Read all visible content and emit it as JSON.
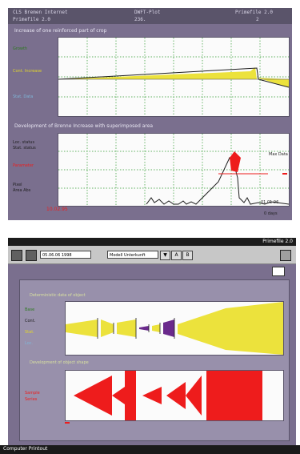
{
  "top_screen": {
    "title_left": "CLS Bremen Internet",
    "title_center": "DWFT-Plot",
    "title_right": "Primefile 2.0",
    "subtitle_left": "Primefile 2.0",
    "subtitle_center": "236.",
    "subtitle_right": "2",
    "panel1_title": "Increase of one reinforced part of crop",
    "panel1_legend": [
      "Growth",
      "Cont. Increase",
      "Stat. Data"
    ],
    "panel2_title": "Development of Brenne Increase with superimposed area",
    "panel2_legend_top": [
      "Loc. status",
      "Stat. status"
    ],
    "panel2_legend_mid": "Parameter",
    "panel2_legend_low": [
      "Pixel",
      "Area Abs"
    ],
    "panel2_date_left": "10.02.95",
    "panel2_date_right": "01.01.96",
    "panel2_right_label": "0 days",
    "panel2_right_top": "Max Data"
  },
  "bottom_screen": {
    "window_title": "Primefile 2.0",
    "toolbar_date": "05.06.06 1998",
    "toolbar_dropdown": "Modell Unterkunft",
    "toolbar_btn_down": "▼",
    "toolbar_btn_a": "A",
    "toolbar_btn_b": "B",
    "panel1_title": "Deterministic data of object",
    "panel1_legend": [
      "Base",
      "Cont.",
      "Stat.",
      "Loc."
    ],
    "panel2_title": "Development of object shape",
    "panel2_legend": [
      "Sample",
      "Series"
    ],
    "status_text": "Computer Printout"
  },
  "colors": {
    "frame": "#7a6f8e",
    "plot_bg": "#fbfbfb",
    "yellow": "#ece23c",
    "red": "#ee1c1c",
    "purple": "#6a2a8c",
    "dark_line": "#222222"
  }
}
